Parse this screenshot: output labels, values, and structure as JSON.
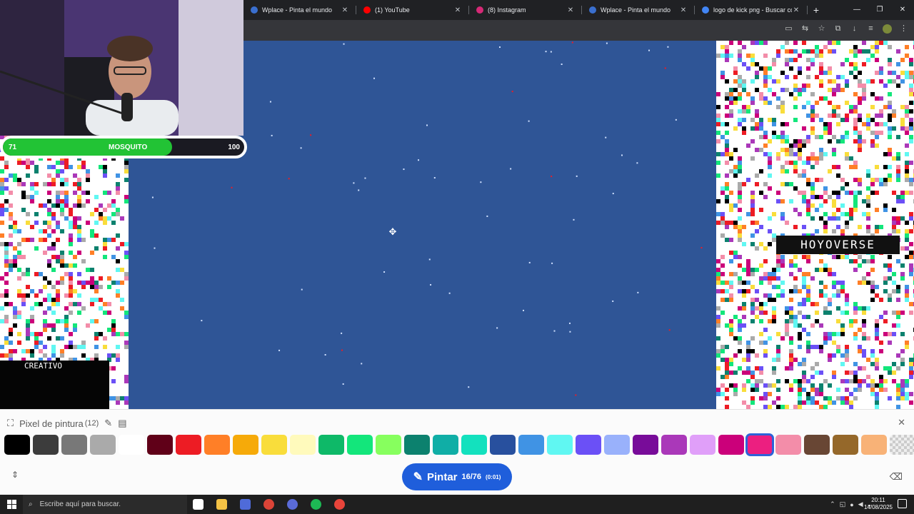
{
  "browser": {
    "tabs": [
      {
        "title": "Wplace - Pinta el mundo",
        "favicon_color": "#3a6fcf",
        "favicon": "wplace-icon"
      },
      {
        "title": "(1) YouTube",
        "favicon_color": "#ff0000",
        "favicon": "youtube-icon"
      },
      {
        "title": "(8) Instagram",
        "favicon_color": "#d62976",
        "favicon": "instagram-icon"
      },
      {
        "title": "Wplace - Pinta el mundo",
        "favicon_color": "#3a6fcf",
        "favicon": "wplace-icon"
      },
      {
        "title": "logo de kick png - Buscar con G",
        "favicon_color": "#4285f4",
        "favicon": "google-icon"
      }
    ],
    "new_tab": "+",
    "window_controls": {
      "minimize": "—",
      "maximize": "❐",
      "close": "✕"
    }
  },
  "stream": {
    "health_bar": {
      "left_value": "71",
      "name": "MOSQUITO",
      "right_value": "100",
      "fill_fraction": 0.7,
      "color": "#22c335"
    }
  },
  "map": {
    "sea_color": "#2f5596",
    "labels": {
      "hoyoverse": "HOYOVERSE",
      "creativo": "CREATIVO"
    }
  },
  "paint_panel": {
    "title": "Pixel de pintura",
    "count": "(12)",
    "palette": [
      "#000000",
      "#3c3c3c",
      "#787878",
      "#aaaaaa",
      "#ffffff",
      "#600018",
      "#ed1c24",
      "#ff7f27",
      "#f6aa09",
      "#f9dd3b",
      "#fffabc",
      "#0eb968",
      "#13e67b",
      "#87ff5e",
      "#0c816e",
      "#10aea6",
      "#13e1be",
      "#28509e",
      "#4093e4",
      "#60f7f2",
      "#6b50f6",
      "#99b1fb",
      "#780c99",
      "#aa38b9",
      "#e09ff9",
      "#cb007a",
      "#ec1f80",
      "#f38da9",
      "#684634",
      "#95682a",
      "#f8b277",
      "transparent"
    ],
    "selected_index": 26,
    "paint_button": {
      "label": "Pintar",
      "charges": "16/76",
      "timer": "(0:01)"
    },
    "accent": "#1f5edb"
  },
  "taskbar": {
    "search_placeholder": "Escribe aquí para buscar.",
    "time": "20:11",
    "date": "14/08/2025",
    "apps": [
      {
        "name": "task-view-icon",
        "color": "#ffffff"
      },
      {
        "name": "file-explorer-icon",
        "color": "#f4c245"
      },
      {
        "name": "store-icon",
        "color": "#4f6bd9"
      },
      {
        "name": "chrome-icon",
        "color": "#db4437"
      },
      {
        "name": "chrome-alt-icon",
        "color": "#5a6bd8"
      },
      {
        "name": "spotify-icon",
        "color": "#1db954"
      },
      {
        "name": "obs-icon",
        "color": "#e8443a"
      }
    ]
  }
}
